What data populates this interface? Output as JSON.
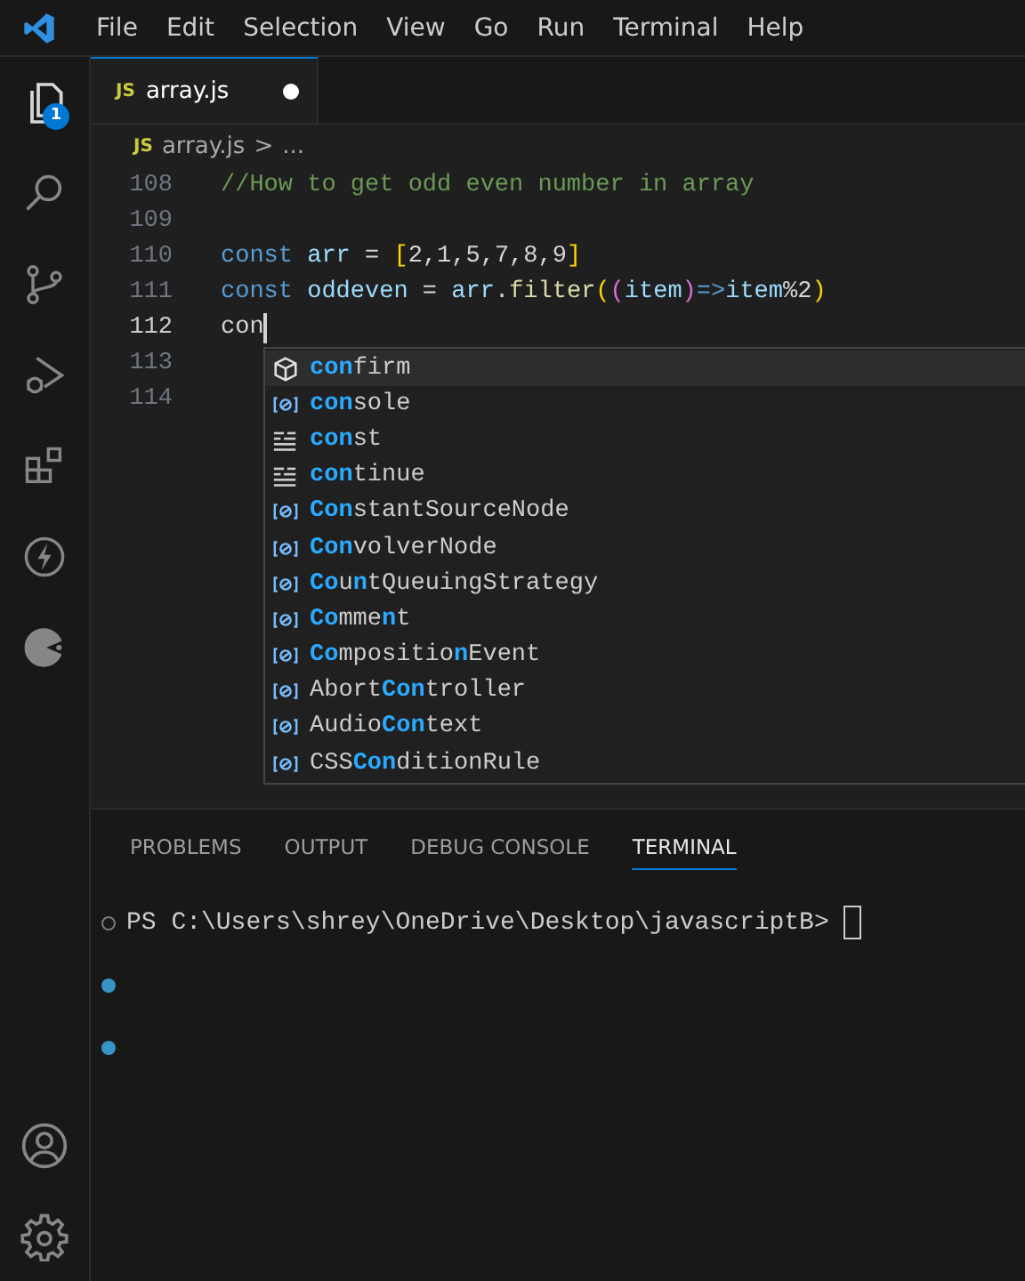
{
  "menu_bar": {
    "items": [
      "File",
      "Edit",
      "Selection",
      "View",
      "Go",
      "Run",
      "Terminal",
      "Help"
    ]
  },
  "activity_bar": {
    "top": [
      {
        "kind": "files",
        "selected": true,
        "badge": "1"
      },
      {
        "kind": "search",
        "selected": false
      },
      {
        "kind": "branch",
        "selected": false
      },
      {
        "kind": "debug",
        "selected": false
      },
      {
        "kind": "extensions",
        "selected": false
      },
      {
        "kind": "lightning",
        "selected": false
      },
      {
        "kind": "pie",
        "selected": false
      }
    ],
    "bottom": [
      {
        "kind": "account",
        "selected": false
      },
      {
        "kind": "settings",
        "selected": false
      }
    ]
  },
  "tabs": [
    {
      "file_badge": "JS",
      "label": "array.js",
      "selected": true,
      "modified": true
    }
  ],
  "breadcrumb": {
    "file_badge": "JS",
    "file": "array.js",
    "separator": ">",
    "rest": "..."
  },
  "editor": {
    "lines": [
      {
        "number": "108",
        "current": false,
        "tokens": [
          {
            "text": "//How to get odd even number in array",
            "kind": "comment"
          }
        ]
      },
      {
        "number": "109",
        "current": false
      },
      {
        "number": "110",
        "current": false,
        "tokens": [
          {
            "text": "const ",
            "kind": "keyword"
          },
          {
            "text": "arr",
            "kind": "variable"
          },
          {
            "text": " = ",
            "kind": "plain"
          },
          {
            "text": "[",
            "kind": "bracket1"
          },
          {
            "text": "2,1,5,7,8,9",
            "kind": "plain"
          },
          {
            "text": "]",
            "kind": "bracket1"
          }
        ]
      },
      {
        "number": "111",
        "current": false,
        "tokens": [
          {
            "text": "const ",
            "kind": "keyword"
          },
          {
            "text": "oddeven",
            "kind": "variable"
          },
          {
            "text": " = ",
            "kind": "plain"
          },
          {
            "text": "arr",
            "kind": "variable"
          },
          {
            "text": ".",
            "kind": "plain"
          },
          {
            "text": "filter",
            "kind": "function"
          },
          {
            "text": "(",
            "kind": "bracket1"
          },
          {
            "text": "(",
            "kind": "bracket2"
          },
          {
            "text": "item",
            "kind": "variable"
          },
          {
            "text": ")",
            "kind": "bracket2"
          },
          {
            "text": "=>",
            "kind": "keyword"
          },
          {
            "text": "item",
            "kind": "variable"
          },
          {
            "text": "%2",
            "kind": "plain"
          },
          {
            "text": ")",
            "kind": "bracket1"
          }
        ]
      },
      {
        "number": "112",
        "current": true,
        "tokens": [
          {
            "text": "con",
            "kind": "plain"
          }
        ]
      },
      {
        "number": "113",
        "current": false
      },
      {
        "number": "114",
        "current": false
      }
    ],
    "suggestions": [
      {
        "kind": "method",
        "selected": true,
        "label": "**con**firm"
      },
      {
        "kind": "variable",
        "selected": false,
        "label": "**con**sole"
      },
      {
        "kind": "keyword",
        "selected": false,
        "label": "**con**st"
      },
      {
        "kind": "keyword",
        "selected": false,
        "label": "**con**tinue"
      },
      {
        "kind": "variable",
        "selected": false,
        "label": "**Con**stantSourceNode"
      },
      {
        "kind": "variable",
        "selected": false,
        "label": "**Con**volverNode"
      },
      {
        "kind": "variable",
        "selected": false,
        "label": "**Co**u**n**tQueuingStrategy"
      },
      {
        "kind": "variable",
        "selected": false,
        "label": "**Co**mme**n**t"
      },
      {
        "kind": "variable",
        "selected": false,
        "label": "**Co**mpositio**n**Event"
      },
      {
        "kind": "variable",
        "selected": false,
        "label": "Abort**Con**troller"
      },
      {
        "kind": "variable",
        "selected": false,
        "label": "Audio**Con**text"
      },
      {
        "kind": "variable",
        "selected": false,
        "label": "CSS**Con**ditionRule"
      }
    ]
  },
  "panel": {
    "tabs": [
      {
        "label": "PROBLEMS",
        "selected": false
      },
      {
        "label": "OUTPUT",
        "selected": false
      },
      {
        "label": "DEBUG CONSOLE",
        "selected": false
      },
      {
        "label": "TERMINAL",
        "selected": true
      }
    ],
    "terminal_lines": [
      {
        "kind": "pending",
        "text": "PS C:\\Users\\shrey\\OneDrive\\Desktop\\javascriptB>",
        "cursor": true
      },
      {
        "kind": "success",
        "cursor": false
      },
      {
        "kind": "success",
        "cursor": false
      }
    ]
  }
}
